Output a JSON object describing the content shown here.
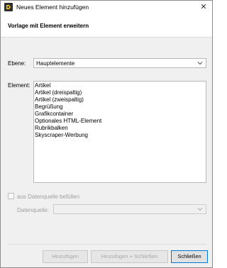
{
  "window": {
    "title": "Neues Element hinzufügen",
    "close_glyph": "✕"
  },
  "header": {
    "title": "Vorlage mit Element erweitern"
  },
  "form": {
    "ebene_label": "Ebene:",
    "ebene_value": "Hauptelemente",
    "element_label": "Element:",
    "elements": [
      "Artikel",
      "Artikel (dreispaltig)",
      "Artikel (zweispaltig)",
      "Begrüßung",
      "Grafikcontainer",
      "Optionales HTML-Element",
      "Rubrikbalken",
      "Skyscraper-Werbung"
    ],
    "datasource_checkbox_label": "aus Datenquelle befüllen",
    "datasource_checked": false,
    "datasource_label": "Datenquelle:",
    "datasource_value": ""
  },
  "buttons": {
    "add": "Hinzufügen",
    "add_close": "Hinzufügen + Schließen",
    "close": "Schließen"
  },
  "colors": {
    "dialog_bg": "#f0f0f0",
    "focus_border": "#0078d7",
    "disabled_text": "#a0a0a0"
  }
}
